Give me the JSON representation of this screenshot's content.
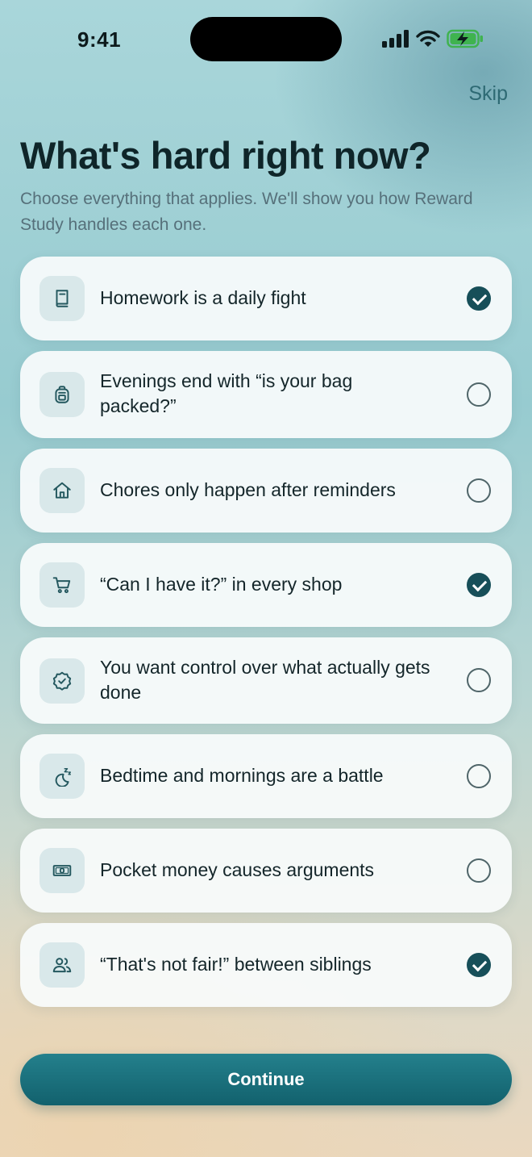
{
  "status_bar": {
    "time": "9:41"
  },
  "header": {
    "skip_label": "Skip",
    "title": "What's hard right now?",
    "subtitle": "Choose everything that applies. We'll show you how Reward Study handles each one."
  },
  "options": [
    {
      "label": "Homework is a daily fight",
      "icon": "book-icon",
      "selected": true
    },
    {
      "label": "Evenings end with “is your bag packed?”",
      "icon": "backpack-icon",
      "selected": false
    },
    {
      "label": "Chores only happen after reminders",
      "icon": "house-icon",
      "selected": false
    },
    {
      "label": "“Can I have it?” in every shop",
      "icon": "cart-icon",
      "selected": true
    },
    {
      "label": "You want control over what actually gets done",
      "icon": "badge-check-icon",
      "selected": false
    },
    {
      "label": "Bedtime and mornings are a battle",
      "icon": "moon-sleep-icon",
      "selected": false
    },
    {
      "label": "Pocket money causes arguments",
      "icon": "banknote-icon",
      "selected": false
    },
    {
      "label": "“That's not fair!” between siblings",
      "icon": "users-icon",
      "selected": true
    }
  ],
  "footer": {
    "continue_label": "Continue"
  },
  "colors": {
    "accent": "#174f59",
    "button": "#1a6e7a",
    "tile": "#d9e8ea"
  }
}
